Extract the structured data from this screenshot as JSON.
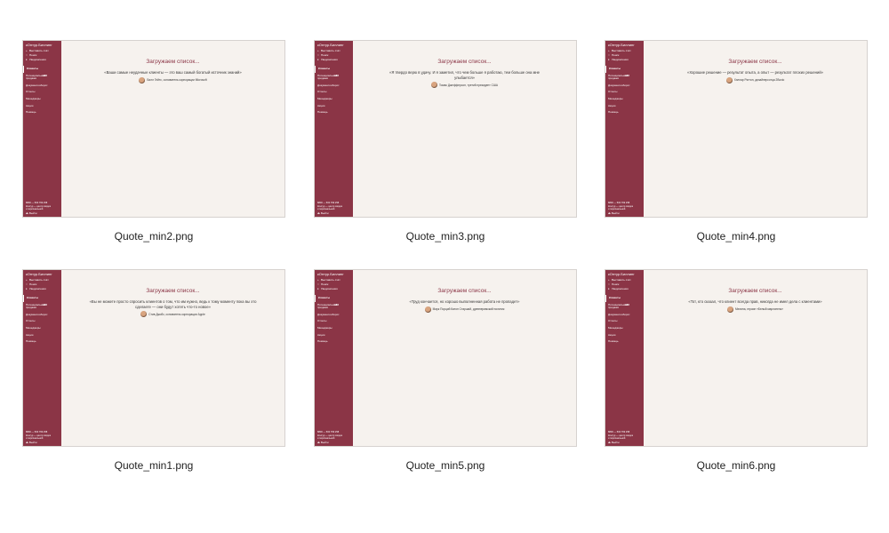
{
  "sidebar": {
    "logo": "кОнтур.Биллинг",
    "top_items": [
      {
        "icon": "plus-icon",
        "label": "Выставить счёт"
      },
      {
        "icon": "search-icon",
        "label": "Поиск"
      },
      {
        "icon": "bell-icon",
        "label": "Уведомления"
      }
    ],
    "nav_items": [
      {
        "label": "Клиенты",
        "badge": ""
      },
      {
        "label": "Потенциальные продажи",
        "badge": "186"
      },
      {
        "label": "Документооборот",
        "badge": ""
      },
      {
        "label": "Отчеты",
        "badge": ""
      },
      {
        "label": "Менеджеры",
        "badge": ""
      },
      {
        "label": "Акции",
        "badge": ""
      },
      {
        "label": "Помощь",
        "badge": ""
      }
    ],
    "footer_lines": [
      "8800 — 500 799 258",
      "Контур — центр скидок",
      "и персональной"
    ],
    "exit_label": "Выйти"
  },
  "loading_text": "Загружаем список...",
  "tiles": [
    {
      "caption": "Quote_min2.png",
      "quote": "«Ваши самые неудачные клиенты — это ваш самый богатый источник знаний»",
      "author": "Билл Гейтс, основатель корпорации Microsoft"
    },
    {
      "caption": "Quote_min3.png",
      "quote": "«Я твердо верю в удачу. И я заметил, что чем больше я работаю, тем больше она мне улыбается»",
      "author": "Томас Джефферсон, третий президент США"
    },
    {
      "caption": "Quote_min4.png",
      "quote": "«Хорошие решение — результат опыта, а опыт — результат плохих решений»",
      "author": "Хэллар Ригтон, дизайнерсотца 2Boxio"
    },
    {
      "caption": "Quote_min1.png",
      "quote": "«Вы не можете просто спросить клиентов о том, что им нужно, ведь к тому моменту пока вы это сделаете — они будут хотеть что-то новое»",
      "author": "Стив Джобс, основатель корпорации Apple"
    },
    {
      "caption": "Quote_min5.png",
      "quote": "«Труд кончается, но хорошо выполненная работа не пропадет»",
      "author": "Марк Порций Катон Старший, древнеримский политик"
    },
    {
      "caption": "Quote_min6.png",
      "quote": "«Тот, кто сказал, что клиент всегда прав, никогда не имел дела с клиентами»",
      "author": "Мелина, героин «Белый марлатель»"
    }
  ]
}
